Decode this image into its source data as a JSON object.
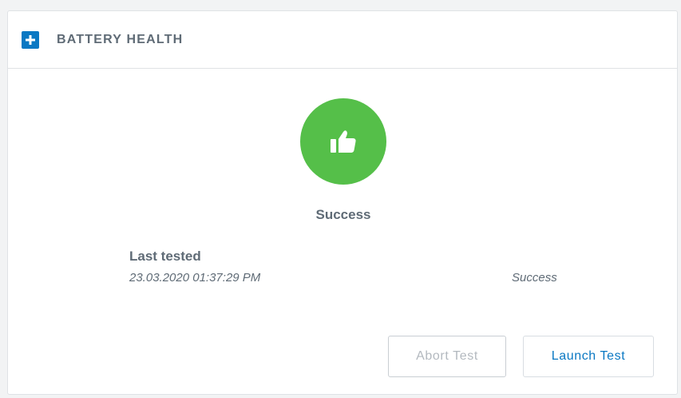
{
  "header": {
    "title": "BATTERY HEALTH",
    "icon": "plus-icon",
    "icon_color": "#0a78c3"
  },
  "status": {
    "icon": "thumbs-up-icon",
    "color": "#55bf49",
    "label": "Success"
  },
  "last_tested": {
    "label": "Last tested",
    "date": "23.03.2020 01:37:29 PM",
    "result": "Success"
  },
  "buttons": {
    "abort_label": "Abort Test",
    "launch_label": "Launch Test"
  }
}
